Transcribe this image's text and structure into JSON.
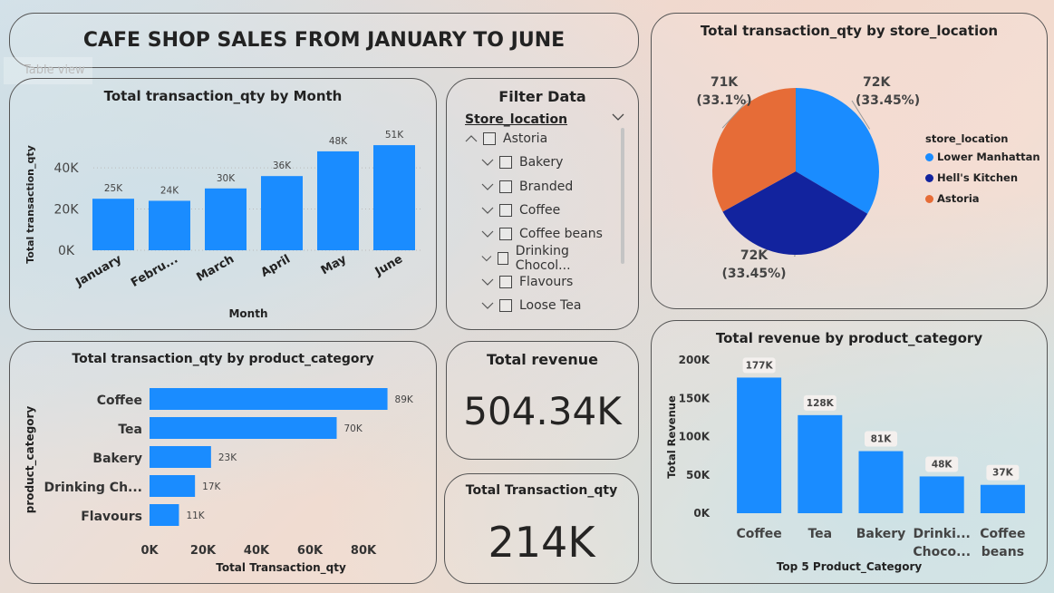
{
  "dashboard": {
    "title": "CAFE SHOP SALES FROM JANUARY TO JUNE",
    "table_view": "Table view"
  },
  "colors": {
    "bar": "#1a8cff",
    "lower_manhattan": "#1a8cff",
    "hells_kitchen": "#12239e",
    "astoria": "#e66c37"
  },
  "month_chart": {
    "title": "Total transaction_qty by Month",
    "chart_data": {
      "type": "bar",
      "categories": [
        "January",
        "Febru...",
        "March",
        "April",
        "May",
        "June"
      ],
      "values": [
        25,
        24,
        30,
        36,
        48,
        51
      ],
      "data_labels": [
        "25K",
        "24K",
        "30K",
        "36K",
        "48K",
        "51K"
      ],
      "xlabel": "Month",
      "ylabel": "Total transaction_qty",
      "yticks": [
        "0K",
        "20K",
        "40K"
      ],
      "ylim": [
        0,
        55
      ],
      "grid": true
    }
  },
  "filter": {
    "title": "Filter Data",
    "field": "Store_location",
    "items": [
      {
        "label": "Astoria",
        "level": 0,
        "expanded": true
      },
      {
        "label": "Bakery",
        "level": 1
      },
      {
        "label": "Branded",
        "level": 1
      },
      {
        "label": "Coffee",
        "level": 1
      },
      {
        "label": "Coffee beans",
        "level": 1
      },
      {
        "label": "Drinking Chocol...",
        "level": 1
      },
      {
        "label": "Flavours",
        "level": 1
      },
      {
        "label": "Loose Tea",
        "level": 1
      }
    ]
  },
  "pie_chart": {
    "title": "Total transaction_qty by store_location",
    "legend_title": "store_location",
    "chart_data": {
      "type": "pie",
      "labels": [
        "Lower Manhattan",
        "Hell's Kitchen",
        "Astoria"
      ],
      "values": [
        72,
        72,
        71
      ],
      "percent_labels": [
        "(33.45%)",
        "(33.45%)",
        "(33.1%)"
      ],
      "value_labels": [
        "72K",
        "72K",
        "71K"
      ],
      "legend": "right"
    }
  },
  "category_chart": {
    "title": "Total transaction_qty by product_category",
    "chart_data": {
      "type": "bar",
      "orientation": "horizontal",
      "categories": [
        "Coffee",
        "Tea",
        "Bakery",
        "Drinking Ch...",
        "Flavours"
      ],
      "values": [
        89,
        70,
        23,
        17,
        11
      ],
      "data_labels": [
        "89K",
        "70K",
        "23K",
        "17K",
        "11K"
      ],
      "xlabel": "Total Transaction_qty",
      "ylabel": "product_category",
      "xticks": [
        "0K",
        "20K",
        "40K",
        "60K",
        "80K"
      ],
      "xlim": [
        0,
        100
      ]
    }
  },
  "kpi_revenue": {
    "title": "Total revenue",
    "value": "504.34K"
  },
  "kpi_qty": {
    "title": "Total Transaction_qty",
    "value": "214K"
  },
  "revenue_chart": {
    "title": "Total revenue by product_category",
    "chart_data": {
      "type": "bar",
      "categories": [
        [
          "Coffee"
        ],
        [
          "Tea"
        ],
        [
          "Bakery"
        ],
        [
          "Drinki...",
          "Choco..."
        ],
        [
          "Coffee",
          "beans"
        ]
      ],
      "values": [
        177,
        128,
        81,
        48,
        37
      ],
      "data_labels": [
        "177K",
        "128K",
        "81K",
        "48K",
        "37K"
      ],
      "xlabel": "Top 5 Product_Category",
      "ylabel": "Total Revenue",
      "yticks": [
        "0K",
        "50K",
        "100K",
        "150K",
        "200K"
      ],
      "ylim": [
        0,
        200
      ]
    }
  }
}
